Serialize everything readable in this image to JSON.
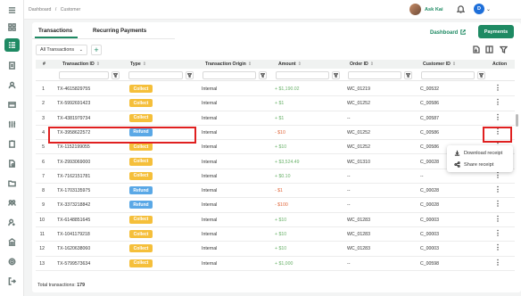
{
  "breadcrumb": [
    "Dashboard",
    "/",
    "Customer"
  ],
  "user": {
    "name": "Ask Kai",
    "initial": "D"
  },
  "tabs": [
    "Transactions",
    "Recurring Payments"
  ],
  "dashboard_link": "Dashboard",
  "payments_button": "Payments",
  "filter_select": "All Transactions",
  "add_button": "+",
  "columns": [
    "#",
    "Transaction ID",
    "Type",
    "Transaction Origin",
    "Amount",
    "Order ID",
    "Customer ID",
    "Action"
  ],
  "rows": [
    {
      "n": "1",
      "id": "TX-4615829755",
      "type": "Collect",
      "origin": "Internal",
      "amount": "+ $1,190.02",
      "order": "WC_01219",
      "customer": "C_00532"
    },
    {
      "n": "2",
      "id": "TX-5992691423",
      "type": "Collect",
      "origin": "Internal",
      "amount": "+ $1",
      "order": "WC_01252",
      "customer": "C_00586"
    },
    {
      "n": "3",
      "id": "TX-4381979734",
      "type": "Collect",
      "origin": "Internal",
      "amount": "+ $1",
      "order": "--",
      "customer": "C_00587"
    },
    {
      "n": "4",
      "id": "TX-3958622572",
      "type": "Refund",
      "origin": "Internal",
      "amount": "- $10",
      "order": "WC_01252",
      "customer": "C_00586"
    },
    {
      "n": "5",
      "id": "TX-1152199055",
      "type": "Collect",
      "origin": "Internal",
      "amount": "+ $10",
      "order": "WC_01252",
      "customer": "C_00586"
    },
    {
      "n": "6",
      "id": "TX-2993069000",
      "type": "Collect",
      "origin": "Internal",
      "amount": "+ $3,524.49",
      "order": "WC_01310",
      "customer": "C_00028"
    },
    {
      "n": "7",
      "id": "TX-7162151781",
      "type": "Collect",
      "origin": "Internal",
      "amount": "+ $0.10",
      "order": "--",
      "customer": "--"
    },
    {
      "n": "8",
      "id": "TX-1703135975",
      "type": "Refund",
      "origin": "Internal",
      "amount": "- $1",
      "order": "--",
      "customer": "C_00028"
    },
    {
      "n": "9",
      "id": "TX-3373218842",
      "type": "Refund",
      "origin": "Internal",
      "amount": "- $100",
      "order": "--",
      "customer": "C_00028"
    },
    {
      "n": "10",
      "id": "TX-6148851645",
      "type": "Collect",
      "origin": "Internal",
      "amount": "+ $10",
      "order": "WC_01283",
      "customer": "C_00003"
    },
    {
      "n": "11",
      "id": "TX-1041179218",
      "type": "Collect",
      "origin": "Internal",
      "amount": "+ $10",
      "order": "WC_01283",
      "customer": "C_00003"
    },
    {
      "n": "12",
      "id": "TX-1620638060",
      "type": "Collect",
      "origin": "Internal",
      "amount": "+ $10",
      "order": "WC_01283",
      "customer": "C_00003"
    },
    {
      "n": "13",
      "id": "TX-5799573634",
      "type": "Collect",
      "origin": "Internal",
      "amount": "+ $1,000",
      "order": "--",
      "customer": "C_00598"
    }
  ],
  "context_menu": [
    "Download receipt",
    "Share receipt"
  ],
  "footer": {
    "label": "Total transactions:",
    "count": "179"
  },
  "colors": {
    "accent": "#1e8a63",
    "collect": "#f5bf3a",
    "refund": "#5aa8e6",
    "highlight": "#e02020"
  }
}
